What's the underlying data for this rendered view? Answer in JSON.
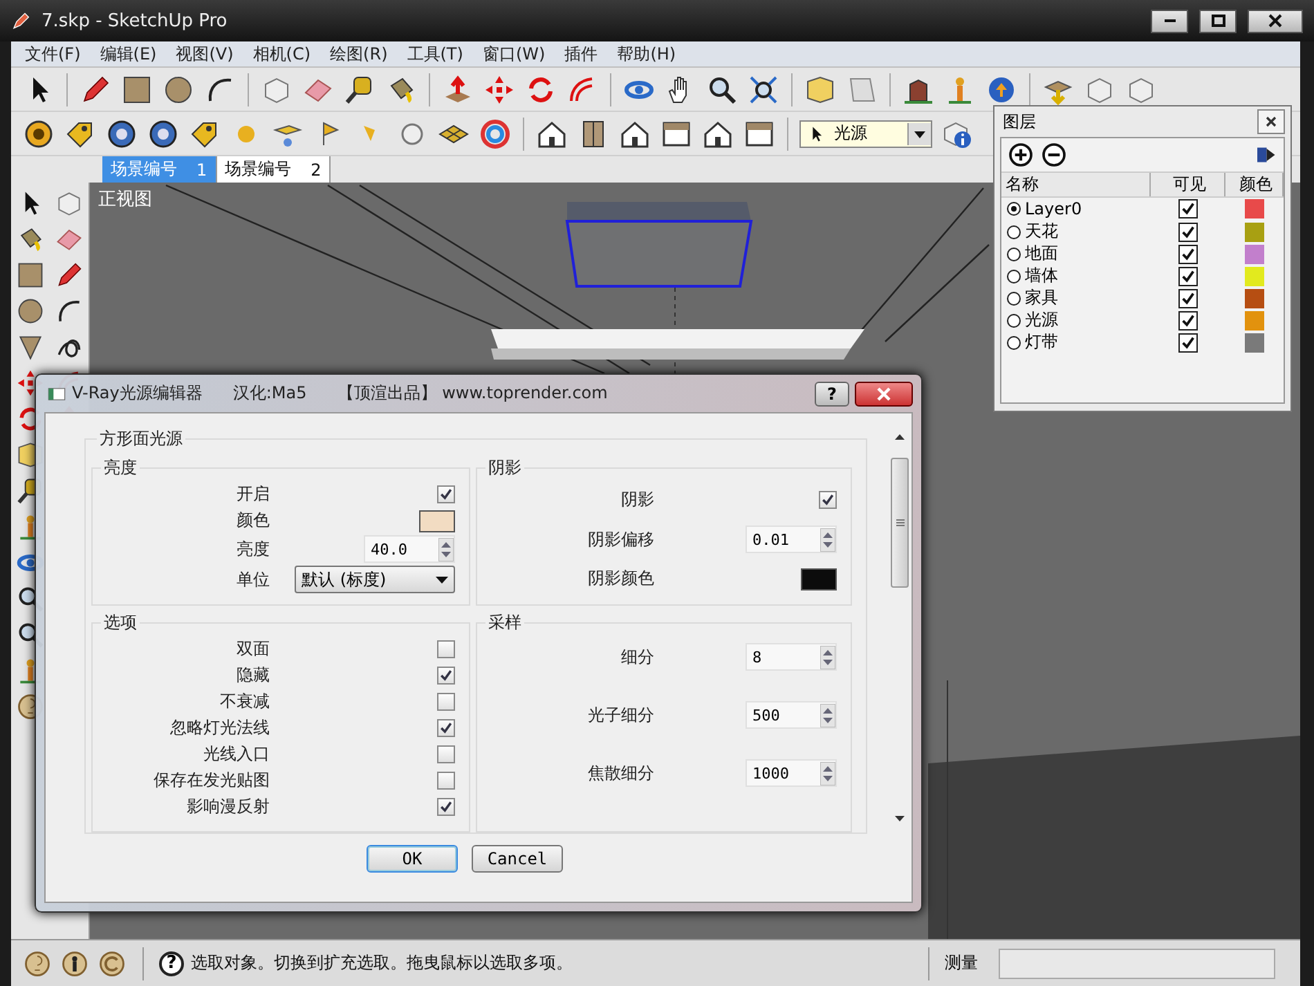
{
  "window": {
    "title": "7.skp - SketchUp Pro"
  },
  "menu": [
    "文件(F)",
    "编辑(E)",
    "视图(V)",
    "相机(C)",
    "绘图(R)",
    "工具(T)",
    "窗口(W)",
    "插件",
    "帮助(H)"
  ],
  "toolbar_dropdown": {
    "value": "光源"
  },
  "scene_tabs": [
    {
      "label": "场景编号",
      "number": "1",
      "selected": true
    },
    {
      "label": "场景编号",
      "number": "2",
      "selected": false
    }
  ],
  "viewport": {
    "label": "正视图"
  },
  "layers_panel": {
    "title": "图层",
    "columns": [
      "名称",
      "可见",
      "颜色"
    ],
    "layers": [
      {
        "name": "Layer0",
        "selected": true,
        "visible": true,
        "color": "#e84a4a"
      },
      {
        "name": "天花",
        "selected": false,
        "visible": true,
        "color": "#a8a012"
      },
      {
        "name": "地面",
        "selected": false,
        "visible": true,
        "color": "#c27fcc"
      },
      {
        "name": "墙体",
        "selected": false,
        "visible": true,
        "color": "#e2ea1e"
      },
      {
        "name": "家具",
        "selected": false,
        "visible": true,
        "color": "#b64e12"
      },
      {
        "name": "光源",
        "selected": false,
        "visible": true,
        "color": "#e2920e"
      },
      {
        "name": "灯带",
        "selected": false,
        "visible": true,
        "color": "#7a7a7a"
      }
    ]
  },
  "dialog": {
    "title_parts": [
      "V-Ray光源编辑器",
      "汉化:Ma5",
      "【顶渲出品】 www.toprender.com"
    ],
    "help_button": "?",
    "section": "方形面光源",
    "groups": [
      {
        "title": "亮度",
        "rows": [
          {
            "kind": "checkbox",
            "label": "开启",
            "checked": true
          },
          {
            "kind": "color",
            "label": "颜色",
            "color": "#f2dcc2"
          },
          {
            "kind": "spinner",
            "label": "亮度",
            "value": "40.0"
          },
          {
            "kind": "dropdown",
            "label": "单位",
            "value": "默认 (标度)"
          }
        ]
      },
      {
        "title": "阴影",
        "rows": [
          {
            "kind": "checkbox",
            "label": "阴影",
            "checked": true
          },
          {
            "kind": "spinner",
            "label": "阴影偏移",
            "value": "0.01"
          },
          {
            "kind": "color",
            "label": "阴影颜色",
            "color": "#0c0c0c"
          }
        ]
      },
      {
        "title": "选项",
        "rows": [
          {
            "kind": "checkbox",
            "label": "双面",
            "checked": false
          },
          {
            "kind": "checkbox",
            "label": "隐藏",
            "checked": true
          },
          {
            "kind": "checkbox",
            "label": "不衰减",
            "checked": false
          },
          {
            "kind": "checkbox",
            "label": "忽略灯光法线",
            "checked": true
          },
          {
            "kind": "checkbox",
            "label": "光线入口",
            "checked": false
          },
          {
            "kind": "checkbox",
            "label": "保存在发光贴图",
            "checked": false
          },
          {
            "kind": "checkbox",
            "label": "影响漫反射",
            "checked": true
          }
        ]
      },
      {
        "title": "采样",
        "rows": [
          {
            "kind": "spinner",
            "label": "细分",
            "value": "8"
          },
          {
            "kind": "spinner",
            "label": "光子细分",
            "value": "500"
          },
          {
            "kind": "spinner",
            "label": "焦散细分",
            "value": "1000"
          }
        ]
      }
    ],
    "buttons": [
      {
        "label": "OK",
        "default": true
      },
      {
        "label": "Cancel",
        "default": false
      }
    ]
  },
  "status_bar": {
    "help_glyph": "?",
    "message": "选取对象。切换到扩充选取。拖曳鼠标以选取多项。",
    "measure_label": "测量"
  }
}
